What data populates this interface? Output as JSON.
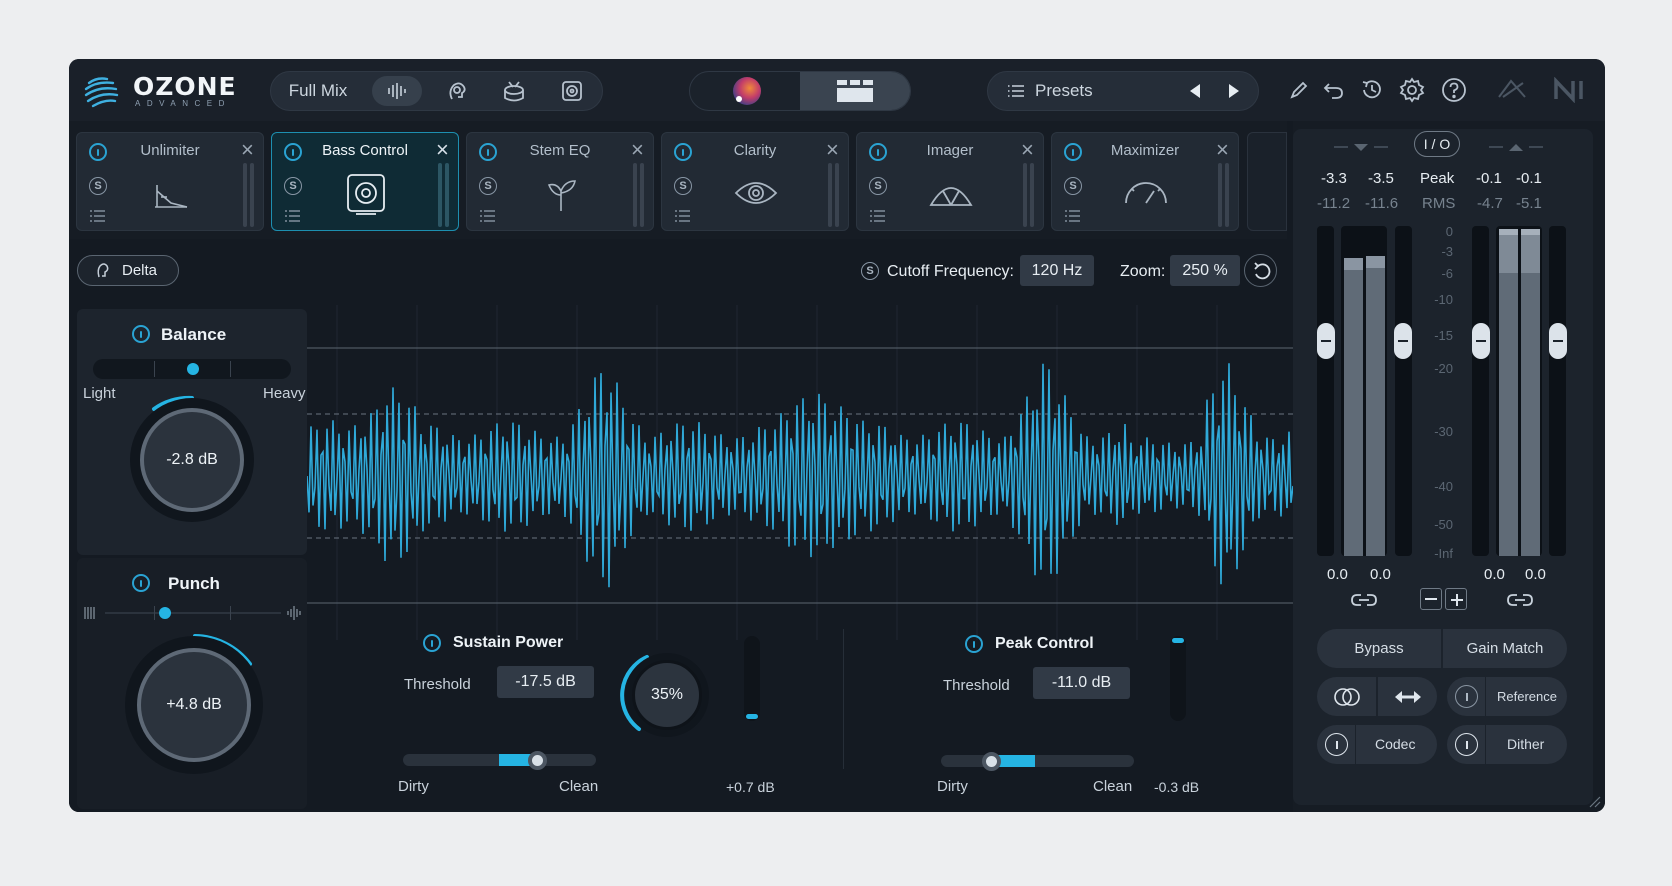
{
  "app": {
    "logo": "OZONE",
    "edition": "ADVANCED"
  },
  "toolbar": {
    "view_label": "Full Mix",
    "presets_label": "Presets"
  },
  "modules": [
    {
      "name": "Unlimiter",
      "icon": "unlimiter-icon",
      "active": false
    },
    {
      "name": "Bass Control",
      "icon": "speaker-icon",
      "active": true
    },
    {
      "name": "Stem EQ",
      "icon": "sprout-icon",
      "active": false
    },
    {
      "name": "Clarity",
      "icon": "eye-icon",
      "active": false
    },
    {
      "name": "Imager",
      "icon": "imager-icon",
      "active": false
    },
    {
      "name": "Maximizer",
      "icon": "gauge-icon",
      "active": false
    }
  ],
  "controls": {
    "delta_label": "Delta",
    "cutoff_label": "Cutoff Frequency:",
    "cutoff_value": "120 Hz",
    "zoom_label": "Zoom:",
    "zoom_value": "250 %"
  },
  "balance": {
    "title": "Balance",
    "left_label": "Light",
    "right_label": "Heavy",
    "value": "-2.8 dB"
  },
  "punch": {
    "title": "Punch",
    "value": "+4.8 dB"
  },
  "sustain": {
    "title": "Sustain Power",
    "threshold_label": "Threshold",
    "threshold_value": "-17.5 dB",
    "left_label": "Dirty",
    "right_label": "Clean",
    "amount": "35%",
    "gain": "+0.7 dB"
  },
  "peak": {
    "title": "Peak Control",
    "threshold_label": "Threshold",
    "threshold_value": "-11.0 dB",
    "left_label": "Dirty",
    "right_label": "Clean",
    "gain": "-0.3 dB"
  },
  "meters": {
    "io_label": "I / O",
    "peak_label": "Peak",
    "rms_label": "RMS",
    "in_peak_l": "-3.3",
    "in_peak_r": "-3.5",
    "in_rms_l": "-11.2",
    "in_rms_r": "-11.6",
    "out_peak_l": "-0.1",
    "out_peak_r": "-0.1",
    "out_rms_l": "-4.7",
    "out_rms_r": "-5.1",
    "scale": [
      "0",
      "-3",
      "-6",
      "-10",
      "-15",
      "-20",
      "-30",
      "-40",
      "-50",
      "-Inf"
    ],
    "in_gain_l": "0.0",
    "in_gain_r": "0.0",
    "out_gain_l": "0.0",
    "out_gain_r": "0.0"
  },
  "bottom_buttons": {
    "bypass": "Bypass",
    "gain_match": "Gain Match",
    "reference": "Reference",
    "codec": "Codec",
    "dither": "Dither"
  },
  "colors": {
    "accent": "#25b4e3",
    "waveform": "#2fa9d8",
    "background": "#141a22"
  }
}
